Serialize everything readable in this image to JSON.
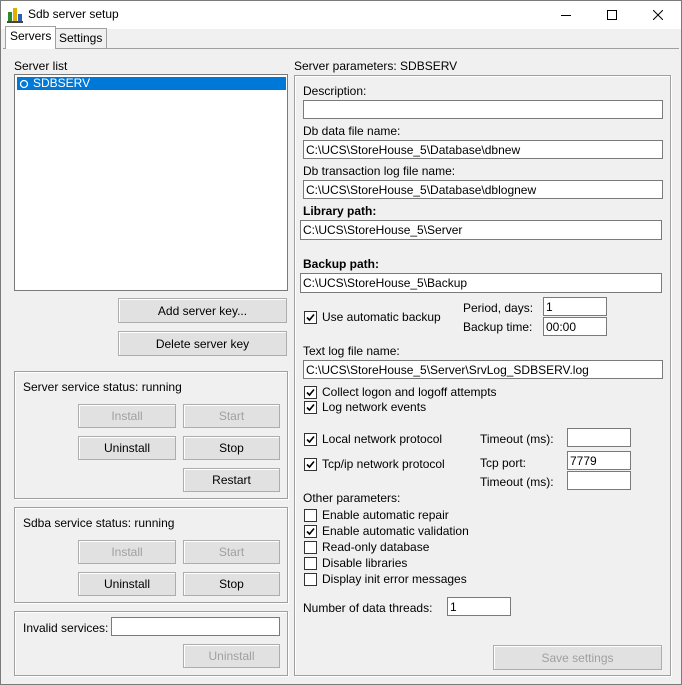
{
  "window": {
    "title": "Sdb server setup"
  },
  "tabs": [
    {
      "label": "Servers"
    },
    {
      "label": "Settings"
    }
  ],
  "server_list": {
    "label": "Server list",
    "items": [
      {
        "name": "SDBSERV",
        "selected": true
      }
    ],
    "add_button": "Add server key...",
    "delete_button": "Delete server key"
  },
  "server_service": {
    "status": "Server service status: running",
    "install": "Install",
    "start": "Start",
    "uninstall": "Uninstall",
    "stop": "Stop",
    "restart": "Restart"
  },
  "sdba_service": {
    "status": "Sdba service status: running",
    "install": "Install",
    "start": "Start",
    "uninstall": "Uninstall",
    "stop": "Stop"
  },
  "invalid_services": {
    "label": "Invalid services:",
    "value": "",
    "uninstall": "Uninstall"
  },
  "params": {
    "title": "Server parameters: SDBSERV",
    "description_label": "Description:",
    "description_value": "",
    "db_data_label": "Db data file name:",
    "db_data_value": "C:\\UCS\\StoreHouse_5\\Database\\dbnew",
    "db_log_label": "Db transaction log file name:",
    "db_log_value": "C:\\UCS\\StoreHouse_5\\Database\\dblognew",
    "library_label": "Library path:",
    "library_value": "C:\\UCS\\StoreHouse_5\\Server",
    "backup_label": "Backup path:",
    "backup_value": "C:\\UCS\\StoreHouse_5\\Backup",
    "auto_backup_label": "Use automatic backup",
    "auto_backup_checked": true,
    "period_label": "Period, days:",
    "period_value": "1",
    "backup_time_label": "Backup time:",
    "backup_time_value": "00:00",
    "text_log_label": "Text log file name:",
    "text_log_value": "C:\\UCS\\StoreHouse_5\\Server\\SrvLog_SDBSERV.log",
    "collect_logon_label": "Collect logon and logoff attempts",
    "collect_logon_checked": true,
    "log_network_label": "Log network events",
    "log_network_checked": true,
    "local_protocol_label": "Local network protocol",
    "local_protocol_checked": true,
    "local_timeout_label": "Timeout (ms):",
    "local_timeout_value": "",
    "tcp_protocol_label": "Tcp/ip network protocol",
    "tcp_protocol_checked": true,
    "tcp_port_label": "Tcp port:",
    "tcp_port_value": "7779",
    "tcp_timeout_label": "Timeout (ms):",
    "tcp_timeout_value": "",
    "other_label": "Other parameters:",
    "auto_repair_label": "Enable automatic repair",
    "auto_repair_checked": false,
    "auto_validation_label": "Enable automatic validation",
    "auto_validation_checked": true,
    "readonly_label": "Read-only database",
    "readonly_checked": false,
    "disable_libs_label": "Disable libraries",
    "disable_libs_checked": false,
    "init_errors_label": "Display init error messages",
    "init_errors_checked": false,
    "threads_label": "Number of data threads:",
    "threads_value": "1",
    "save_button": "Save settings"
  },
  "icons": {
    "app": "database-server-icon",
    "minimize": "minimize-icon",
    "maximize": "maximize-icon",
    "close": "close-icon",
    "server_item": "server-icon"
  },
  "colors": {
    "selection": "#0078d7",
    "disabled_text": "#a0a0a0",
    "window_bg": "#f0f0f0"
  }
}
